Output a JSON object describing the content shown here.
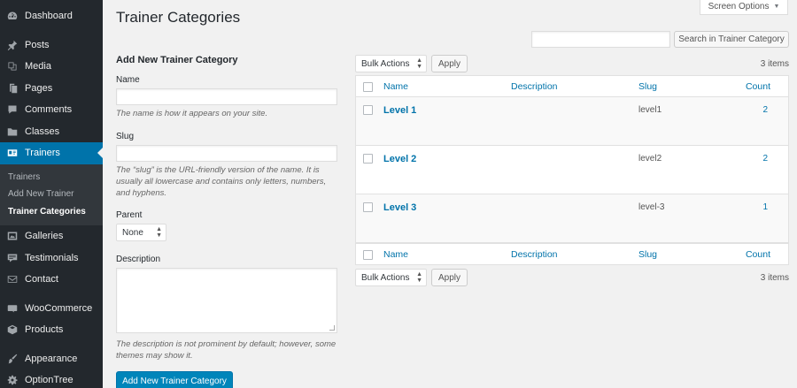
{
  "sidebar": {
    "items": [
      {
        "label": "Dashboard",
        "icon": "dashboard-icon"
      },
      {
        "label": "Posts",
        "icon": "pushpin-icon"
      },
      {
        "label": "Media",
        "icon": "media-icon"
      },
      {
        "label": "Pages",
        "icon": "pages-icon"
      },
      {
        "label": "Comments",
        "icon": "comment-icon"
      },
      {
        "label": "Classes",
        "icon": "folder-icon"
      },
      {
        "label": "Trainers",
        "icon": "id-card-icon"
      },
      {
        "label": "Galleries",
        "icon": "gallery-icon"
      },
      {
        "label": "Testimonials",
        "icon": "testimonial-icon"
      },
      {
        "label": "Contact",
        "icon": "envelope-icon"
      },
      {
        "label": "WooCommerce",
        "icon": "woocommerce-icon"
      },
      {
        "label": "Products",
        "icon": "archive-icon"
      },
      {
        "label": "Appearance",
        "icon": "paintbrush-icon"
      },
      {
        "label": "OptionTree",
        "icon": "gear-icon"
      }
    ],
    "submenu": [
      "Trainers",
      "Add New Trainer",
      "Trainer Categories"
    ]
  },
  "header": {
    "title": "Trainer Categories",
    "screen_options": "Screen Options",
    "search_button": "Search in Trainer Category"
  },
  "form": {
    "title": "Add New Trainer Category",
    "name_label": "Name",
    "name_help": "The name is how it appears on your site.",
    "slug_label": "Slug",
    "slug_help": "The “slug” is the URL-friendly version of the name. It is usually all lowercase and contains only letters, numbers, and hyphens.",
    "parent_label": "Parent",
    "parent_value": "None",
    "description_label": "Description",
    "description_help": "The description is not prominent by default; however, some themes may show it.",
    "submit_label": "Add New Trainer Category"
  },
  "table": {
    "bulk_actions": "Bulk Actions",
    "apply": "Apply",
    "items_count": "3 items",
    "columns": {
      "name": "Name",
      "description": "Description",
      "slug": "Slug",
      "count": "Count"
    },
    "rows": [
      {
        "name": "Level 1",
        "description": "",
        "slug": "level1",
        "count": "2"
      },
      {
        "name": "Level 2",
        "description": "",
        "slug": "level2",
        "count": "2"
      },
      {
        "name": "Level 3",
        "description": "",
        "slug": "level-3",
        "count": "1"
      }
    ]
  },
  "colors": {
    "sidebar_bg": "#23282d",
    "active_bg": "#0073aa",
    "link": "#0073aa",
    "primary_button": "#0085ba"
  }
}
